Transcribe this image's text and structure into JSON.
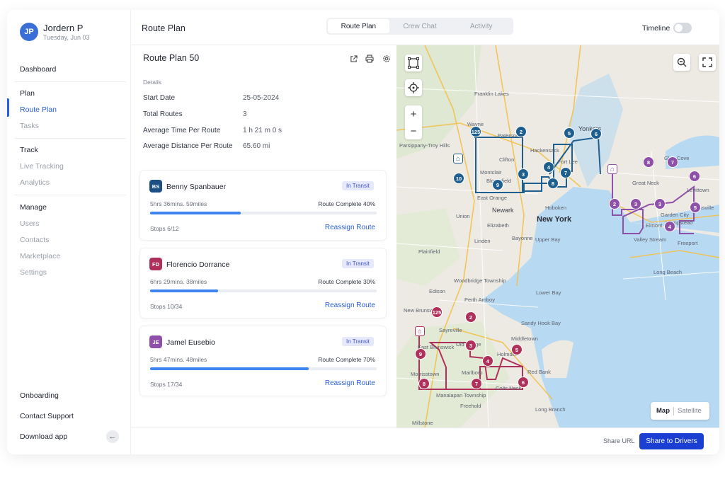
{
  "user": {
    "initials": "JP",
    "name": "Jordern P",
    "date": "Tuesday, Jun 03"
  },
  "sidebar": {
    "dashboard": "Dashboard",
    "plan_header": "Plan",
    "route_plan": "Route Plan",
    "tasks": "Tasks",
    "track_header": "Track",
    "live_tracking": "Live Tracking",
    "analytics": "Analytics",
    "manage_header": "Manage",
    "users": "Users",
    "contacts": "Contacts",
    "marketplace": "Marketplace",
    "settings": "Settings",
    "onboarding": "Onboarding",
    "contact_support": "Contact Support",
    "download_app": "Download app",
    "collapse_icon": "←"
  },
  "header": {
    "title": "Route Plan",
    "tabs": [
      "Route Plan",
      "Crew Chat",
      "Activity"
    ],
    "timeline_label": "Timeline"
  },
  "plan": {
    "name": "Route Plan 50",
    "details_label": "Details",
    "rows": [
      {
        "label": "Start Date",
        "value": "25-05-2024"
      },
      {
        "label": "Total Routes",
        "value": "3"
      },
      {
        "label": "Average Time Per Route",
        "value": "1 h 21 m 0 s"
      },
      {
        "label": "Average Distance Per Route",
        "value": "65.60 mi"
      }
    ]
  },
  "drivers": [
    {
      "initials": "BS",
      "color": "#1d4f86",
      "name": "Benny Spanbauer",
      "status": "In Transit",
      "time": "5hrs 36mins.  59miles",
      "complete_label": "Route Complete 40%",
      "progress": 0.4,
      "stops": "Stops  6/12",
      "action": "Reassign Route"
    },
    {
      "initials": "FD",
      "color": "#b0305c",
      "name": "Florencio Dorrance",
      "status": "In Transit",
      "time": "6hrs 29mins.  38miles",
      "complete_label": "Route Complete 30%",
      "progress": 0.3,
      "stops": "Stops  10/34",
      "action": "Reassign Route"
    },
    {
      "initials": "JE",
      "color": "#8e50a8",
      "name": "Jamel Eusebio",
      "status": "In Transit",
      "time": "5hrs 47mins.  48miles",
      "complete_label": "Route Complete 70%",
      "progress": 0.7,
      "stops": "Stops  17/34",
      "action": "Reassign Route"
    }
  ],
  "map": {
    "toggle_map": "Map",
    "toggle_satellite": "Satellite",
    "zoom_in": "+",
    "zoom_out": "−",
    "labels": {
      "newyork": "New York",
      "newark": "Newark",
      "yonkers": "Yonkers",
      "paterson": "Paterson",
      "clifton": "Clifton",
      "bloomfield": "Bloomfield",
      "hoboken": "Hoboken",
      "bayonne": "Bayonne",
      "hempstead": "Hempstead",
      "freeport": "Freeport",
      "elmont": "Elmont",
      "longbeach": "Long Beach",
      "hicksville": "Hicksville",
      "greatneck": "Great Neck",
      "glencove": "Glen Cove",
      "valleystream": "Valley Stream",
      "oldbridge": "Old Bridge",
      "marlboro": "Marlboro",
      "freehold": "Freehold",
      "redbank": "Red Bank",
      "manalapan": "Manalapan Township",
      "morristown": "Morrisstown",
      "plainfield": "Plainfield",
      "woodbridge": "Woodbridge Township",
      "newbrunswick": "New Brunswick",
      "millstone": "Millstone",
      "franklinlakes": "Franklin Lakes",
      "wayne": "Wayne",
      "fortlee": "Fort Lee",
      "hackensack": "Hackensack",
      "parsippany": "Parsippany-Troy Hills",
      "montclair": "Montclair",
      "eastorange": "East Orange",
      "union": "Union",
      "elizabeth": "Elizabeth",
      "lindenwold": "Linden",
      "edison": "Edison",
      "perth": "Perth Amboy",
      "sayreville": "Sayreville",
      "holmdel": "Holmdel",
      "colts": "Colts Neck",
      "middletown": "Middletown",
      "longbranch": "Long Branch",
      "gardencity": "Garden City",
      "levittown": "Levittown",
      "eastbrunswick": "East Brunswick",
      "sandyhook": "Sandy Hook Bay",
      "lowerbay": "Lower Bay",
      "upperbay": "Upper Bay"
    },
    "markers_blue": [
      "125",
      "2",
      "5",
      "6",
      "10",
      "3",
      "4",
      "7",
      "9",
      "8"
    ],
    "markers_purple": [
      "8",
      "7",
      "6",
      "2",
      "3",
      "3",
      "5",
      "4"
    ],
    "markers_red": [
      "125",
      "2",
      "3",
      "5",
      "4",
      "9",
      "8",
      "7",
      "6"
    ]
  },
  "footer": {
    "share_url": "Share URL",
    "share_drivers": "Share to Drivers"
  }
}
